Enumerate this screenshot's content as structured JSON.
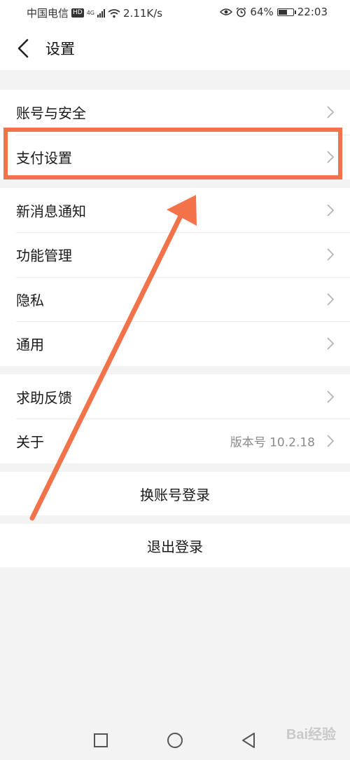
{
  "status_bar": {
    "carrier": "中国电信",
    "hd_badge": "HD",
    "network_type": "4G",
    "network_speed": "2.11K/s",
    "battery_percent": "64%",
    "battery_level": 0.64,
    "time": "22:03",
    "icons": [
      "hd-icon",
      "signal-icon",
      "wifi-icon",
      "eye-icon",
      "alarm-icon",
      "battery-icon"
    ]
  },
  "header": {
    "title": "设置",
    "back_icon": "chevron-left-icon"
  },
  "groups": {
    "account": {
      "items": [
        {
          "label": "账号与安全"
        },
        {
          "label": "支付设置"
        }
      ]
    },
    "general": {
      "items": [
        {
          "label": "新消息通知"
        },
        {
          "label": "功能管理"
        },
        {
          "label": "隐私"
        },
        {
          "label": "通用"
        }
      ]
    },
    "help": {
      "items": [
        {
          "label": "求助反馈"
        },
        {
          "label": "关于",
          "value": "版本号 10.2.18"
        }
      ]
    }
  },
  "actions": {
    "switch_account": "换账号登录",
    "logout": "退出登录"
  },
  "annotation": {
    "highlight_color": "#f2734a",
    "highlighted_item": "支付设置"
  },
  "navbar": {
    "icons": [
      "recent-apps-icon",
      "home-icon",
      "back-triangle-icon"
    ]
  },
  "watermark": {
    "text": "Bai经验"
  }
}
